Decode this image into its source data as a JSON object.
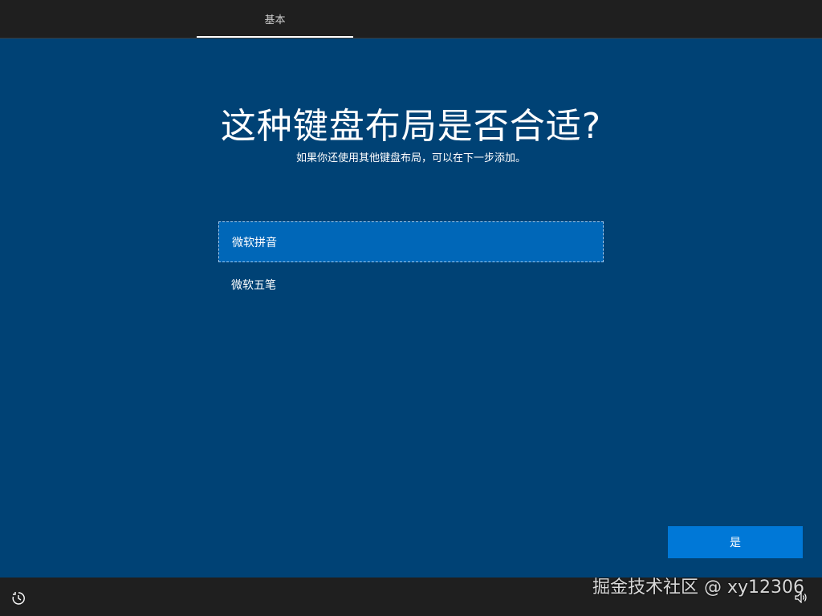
{
  "header": {
    "tab_label": "基本"
  },
  "main": {
    "title": "这种键盘布局是否合适?",
    "subtitle": "如果你还使用其他键盘布局，可以在下一步添加。",
    "options": [
      {
        "label": "微软拼音",
        "selected": true
      },
      {
        "label": "微软五笔",
        "selected": false
      }
    ],
    "confirm_label": "是"
  },
  "footer": {
    "watermark": "掘金技术社区 @ xy12306",
    "icons": [
      "accessibility-icon",
      "volume-icon"
    ]
  },
  "colors": {
    "background": "#004275",
    "bar": "#1f1f1f",
    "selected_option": "#0067b8",
    "button": "#0078d7"
  }
}
